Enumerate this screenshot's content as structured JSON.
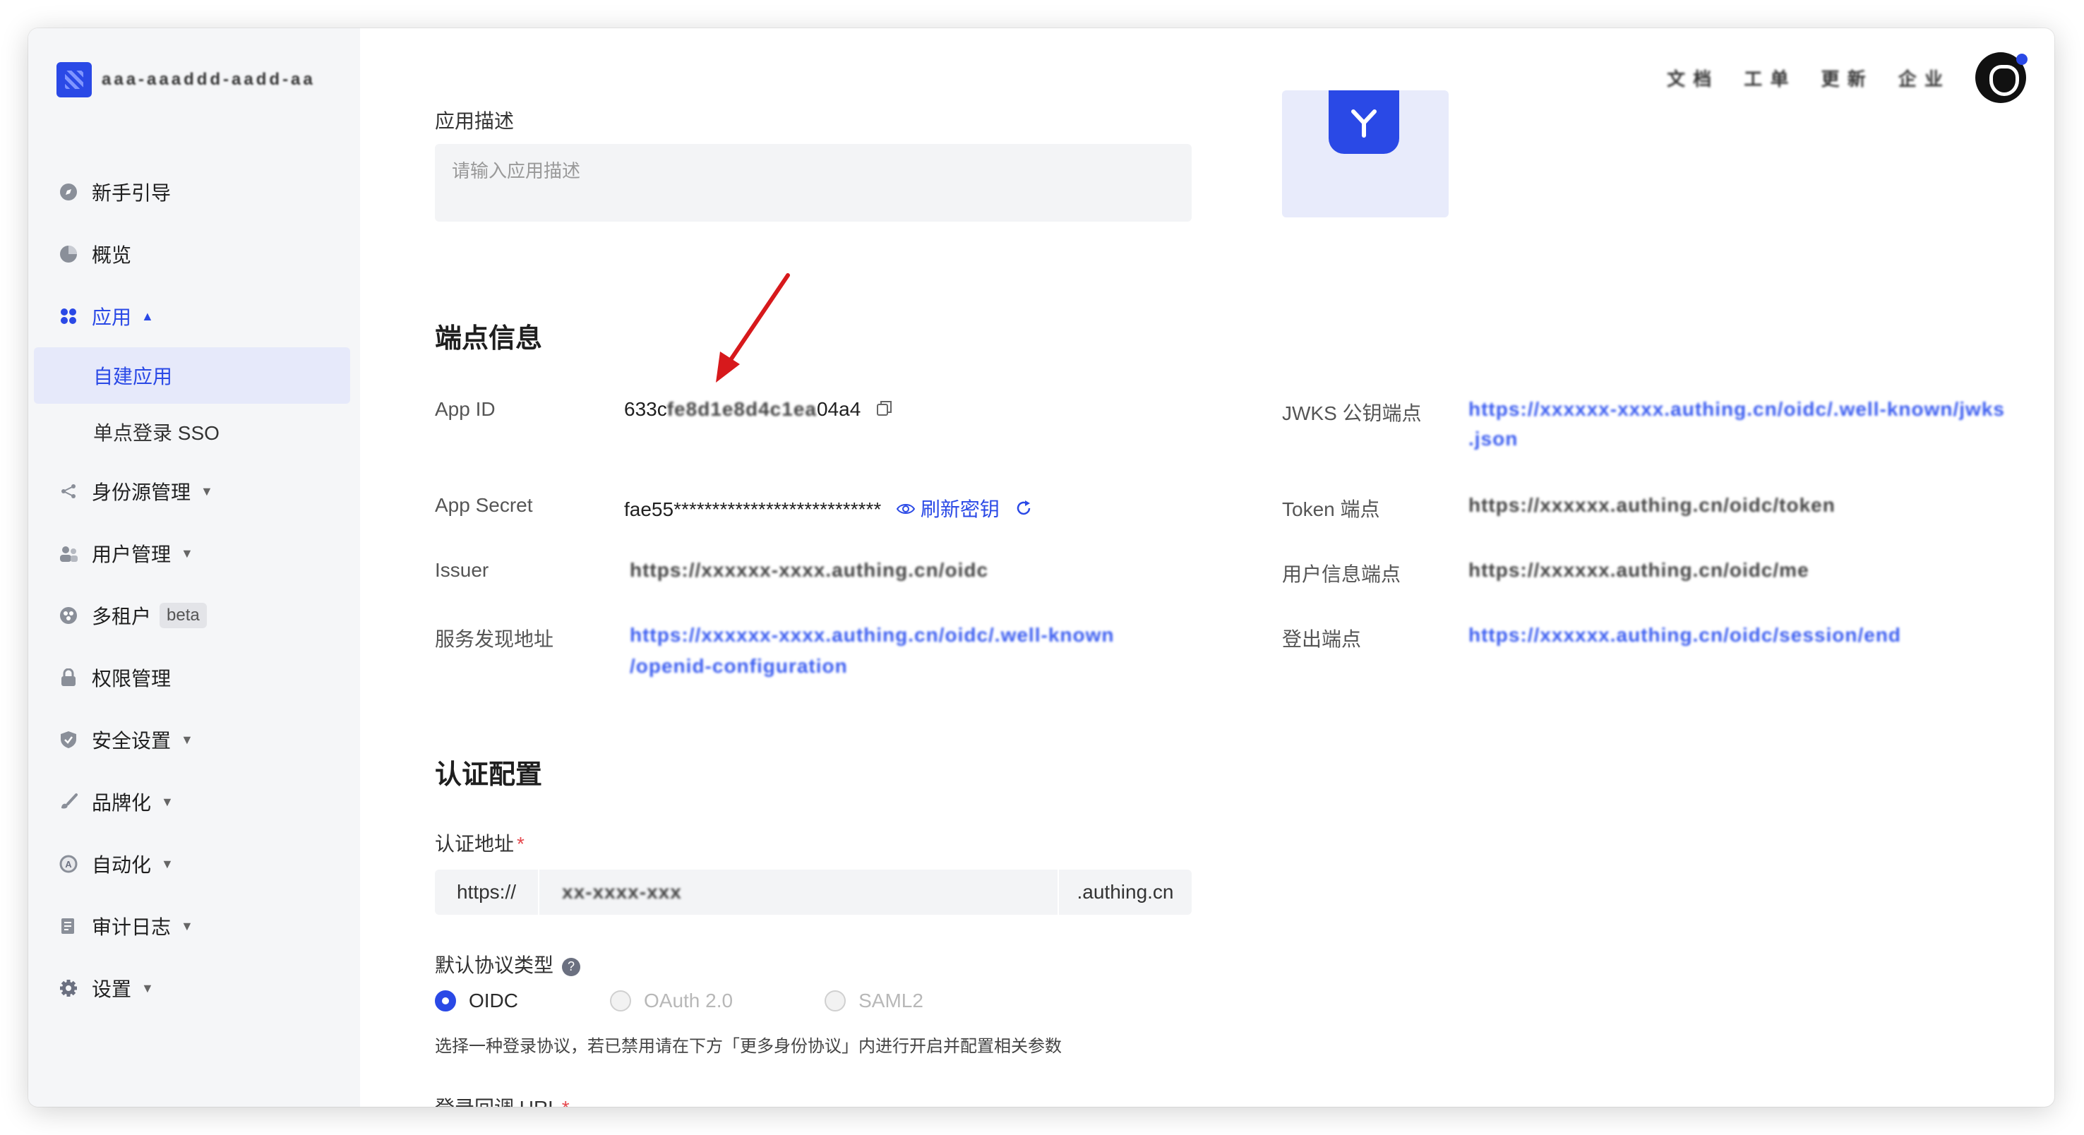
{
  "sidebar": {
    "brand_name": "aaa-aaaddd-aadd-aa",
    "items": [
      {
        "label": "新手引导",
        "icon": "compass-icon"
      },
      {
        "label": "概览",
        "icon": "pie-chart-icon"
      },
      {
        "label": "应用",
        "icon": "apps-icon",
        "expanded": true
      },
      {
        "label": "自建应用",
        "selected": true
      },
      {
        "label": "单点登录 SSO"
      },
      {
        "label": "身份源管理",
        "icon": "share-icon"
      },
      {
        "label": "用户管理",
        "icon": "users-icon"
      },
      {
        "label": "多租户",
        "icon": "tenant-icon",
        "badge": "beta"
      },
      {
        "label": "权限管理",
        "icon": "lock-icon"
      },
      {
        "label": "安全设置",
        "icon": "shield-icon"
      },
      {
        "label": "品牌化",
        "icon": "brush-icon"
      },
      {
        "label": "自动化",
        "icon": "automation-icon"
      },
      {
        "label": "审计日志",
        "icon": "log-icon"
      },
      {
        "label": "设置",
        "icon": "gear-icon"
      }
    ]
  },
  "topbar": {
    "links": [
      "文 档",
      "工 单",
      "更 新",
      "企 业"
    ]
  },
  "form": {
    "desc_label": "应用描述",
    "desc_placeholder": "请输入应用描述"
  },
  "endpoint": {
    "title": "端点信息",
    "app_id_label": "App ID",
    "app_id_value": "633c",
    "app_id_blur": "fe8d1e8d4c1ea",
    "app_id_tail": "04a4",
    "app_secret_label": "App Secret",
    "app_secret_value": "fae55***************************",
    "refresh_label": "刷新密钥",
    "issuer_label": "Issuer",
    "issuer_value": "https://xxxxxx-xxxx.authing.cn/oidc",
    "discovery_label": "服务发现地址",
    "discovery_value_1": "https://xxxxxx-xxxx.authing.cn/oidc/.well-known",
    "discovery_value_2": "/openid-configuration",
    "jwks_label": "JWKS 公钥端点",
    "jwks_value_1": "https://xxxxxx-xxxx.authing.cn/oidc/.well-known/jwks",
    "jwks_value_2": ".json",
    "token_label": "Token 端点",
    "token_value": "https://xxxxxx.authing.cn/oidc/token",
    "userinfo_label": "用户信息端点",
    "userinfo_value": "https://xxxxxx.authing.cn/oidc/me",
    "logout_label": "登出端点",
    "logout_value": "https://xxxxxx.authing.cn/oidc/session/end"
  },
  "auth": {
    "title": "认证配置",
    "url_label": "认证地址",
    "url_prefix": "https://",
    "url_value": "xx-xxxx-xxx",
    "url_suffix": ".authing.cn",
    "protocol_label": "默认协议类型",
    "protocols": [
      {
        "label": "OIDC",
        "state": "checked"
      },
      {
        "label": "OAuth 2.0",
        "state": "disabled"
      },
      {
        "label": "SAML2",
        "state": "disabled"
      }
    ],
    "hint": "选择一种登录协议，若已禁用请在下方「更多身份协议」内进行开启并配置相关参数",
    "callback_label": "登录回调 URL"
  },
  "colors": {
    "accent": "#2a49e6",
    "annotation_arrow": "#d7191c"
  }
}
